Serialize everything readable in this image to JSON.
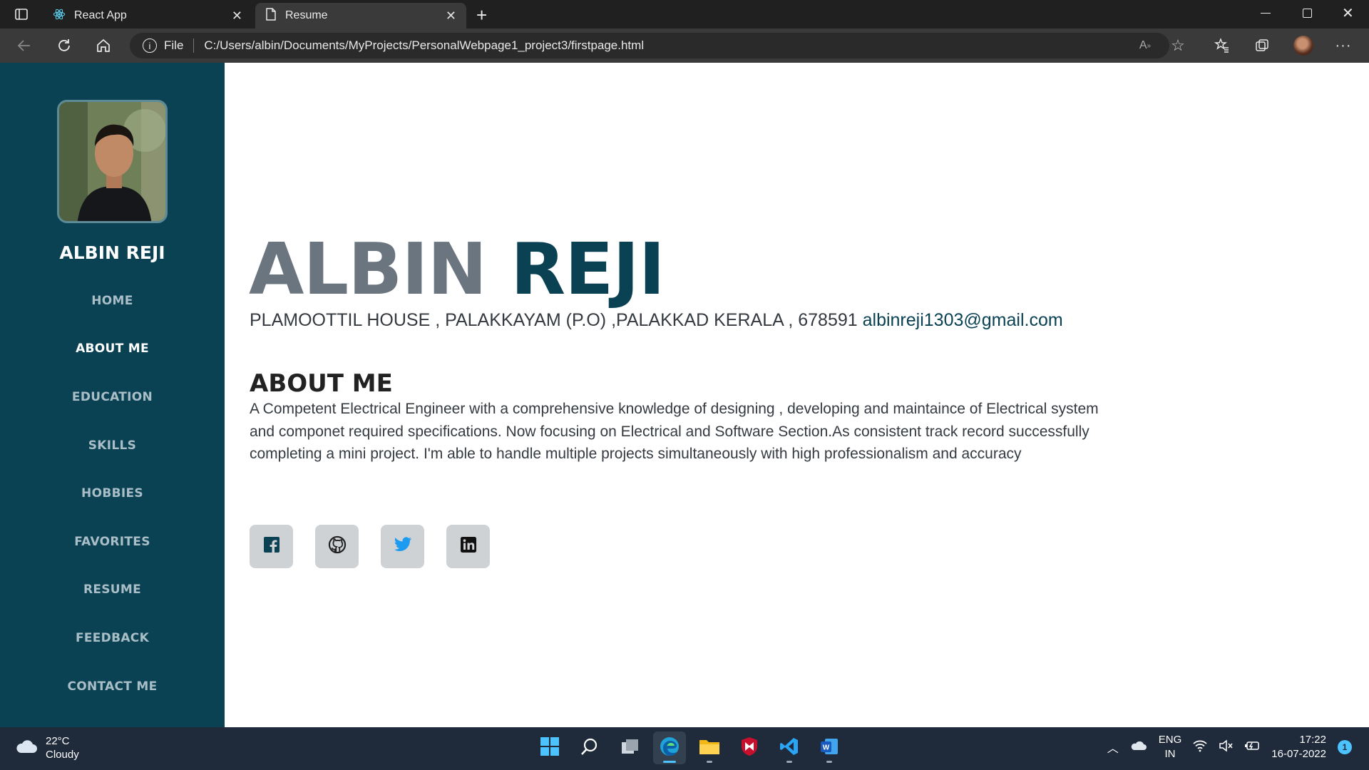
{
  "browser": {
    "tabs": [
      {
        "label": "React App",
        "active": false
      },
      {
        "label": "Resume",
        "active": true
      }
    ],
    "address_scheme": "File",
    "url": "C:/Users/albin/Documents/MyProjects/PersonalWebpage1_project3/firstpage.html"
  },
  "sidebar": {
    "name": "ALBIN REJI",
    "items": [
      {
        "label": "HOME"
      },
      {
        "label": "ABOUT ME"
      },
      {
        "label": "EDUCATION"
      },
      {
        "label": "SKILLS"
      },
      {
        "label": "HOBBIES"
      },
      {
        "label": "FAVORITES"
      },
      {
        "label": "RESUME"
      },
      {
        "label": "FEEDBACK"
      },
      {
        "label": "CONTACT ME"
      }
    ],
    "active_item": "ABOUT ME"
  },
  "main": {
    "first_name": "ALBIN",
    "last_name": "REJI",
    "address": "PLAMOOTTIL HOUSE , PALAKKAYAM (P.O) ,PALAKKAD KERALA , 678591",
    "email": "albinreji1303@gmail.com",
    "about_heading": "ABOUT ME",
    "about_text": "A Competent Electrical Engineer with a comprehensive knowledge of designing , developing and maintaince of Electrical system and componet required specifications. Now focusing on Electrical and Software Section.As consistent track record successfully completing a mini project. I'm able to handle multiple projects simultaneously with high professionalism and accuracy",
    "socials": [
      {
        "icon": "facebook-icon"
      },
      {
        "icon": "github-icon"
      },
      {
        "icon": "twitter-icon"
      },
      {
        "icon": "linkedin-icon"
      }
    ]
  },
  "colors": {
    "sidebar_bg": "#0a4254",
    "accent": "#0a4254",
    "first_name": "#6b7580",
    "social_bg": "#cfd2d5"
  },
  "taskbar": {
    "temperature": "22°C",
    "condition": "Cloudy",
    "language": "ENG",
    "region": "IN",
    "time": "17:22",
    "date": "16-07-2022",
    "notification_count": "1"
  }
}
